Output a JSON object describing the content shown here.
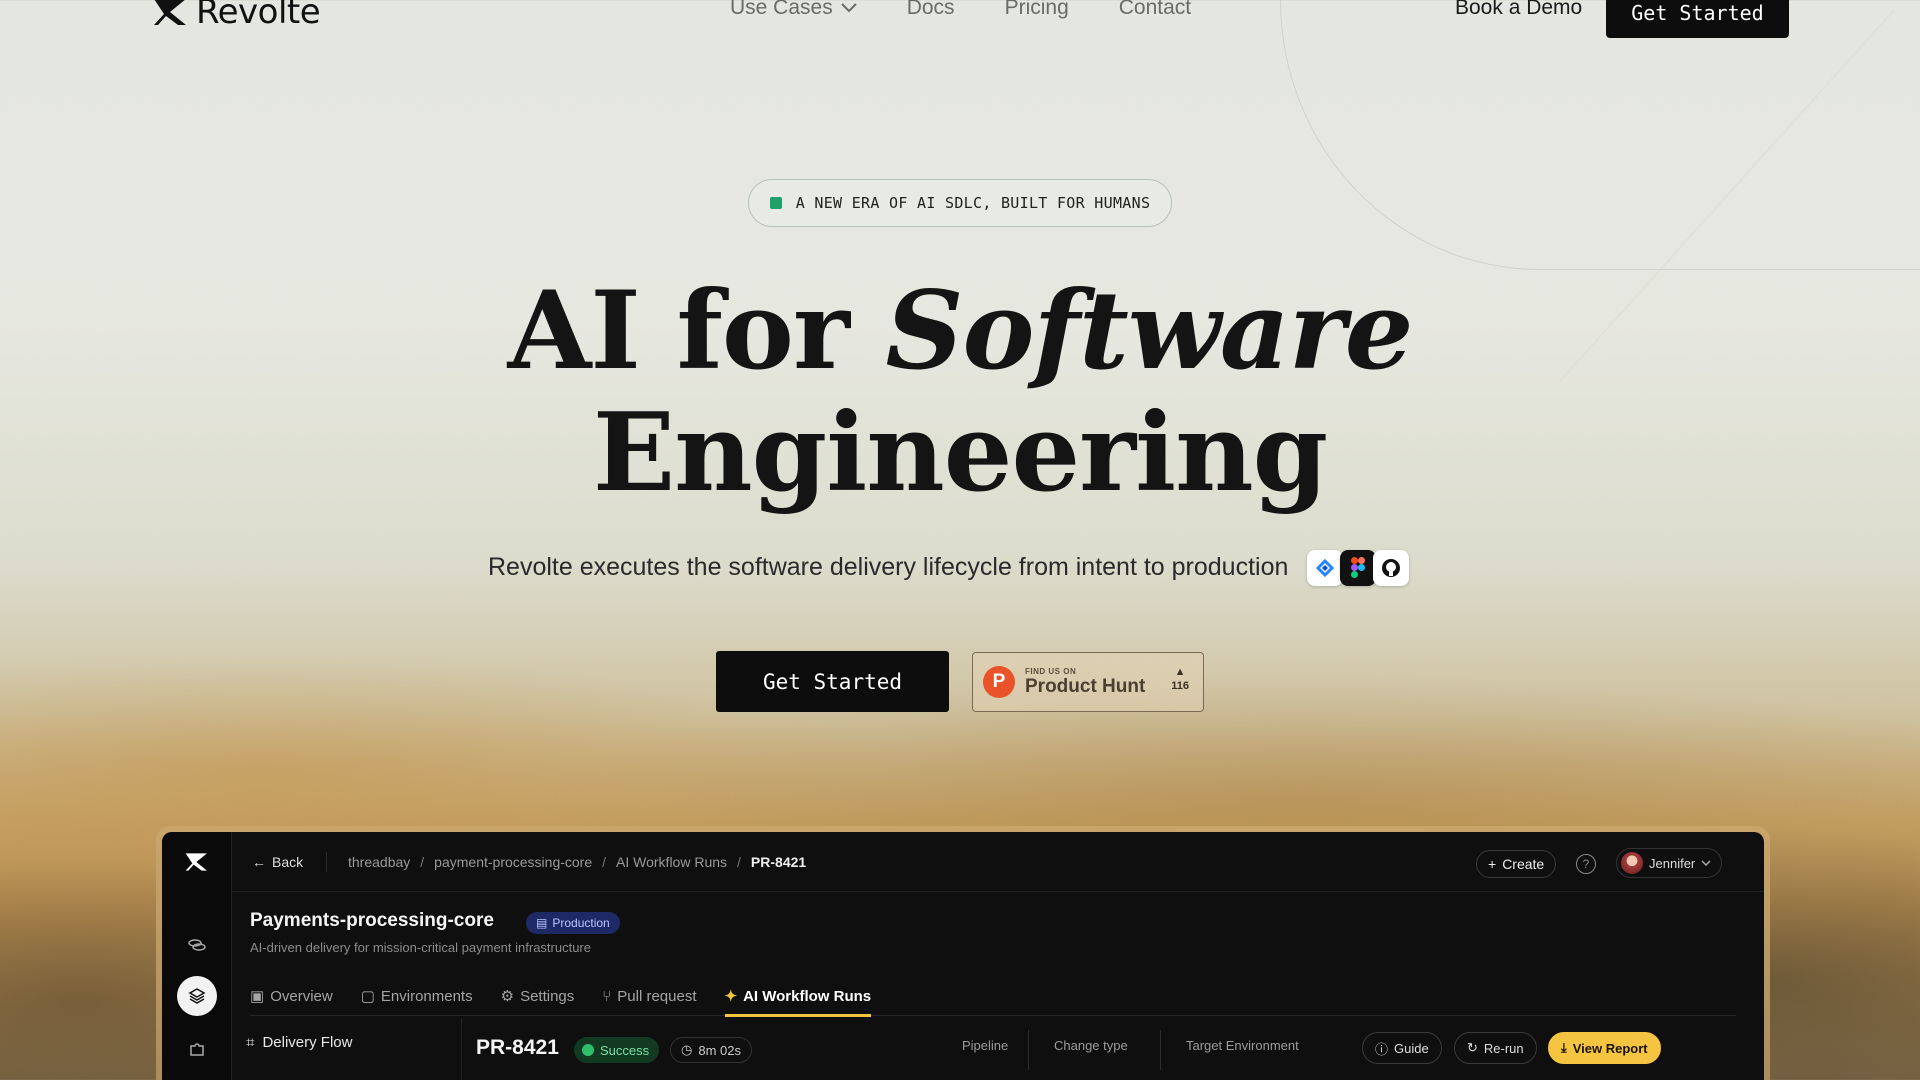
{
  "nav": {
    "brand": "Revolte",
    "links": [
      {
        "label": "Use Cases",
        "has_dropdown": true
      },
      {
        "label": "Docs"
      },
      {
        "label": "Pricing"
      },
      {
        "label": "Contact"
      }
    ],
    "book_demo": "Book a Demo",
    "get_started": "Get Started"
  },
  "hero": {
    "badge": "A NEW ERA OF AI SDLC, BUILT FOR HUMANS",
    "headline_plain": "AI for ",
    "headline_italic": "Software",
    "headline_line2": "Engineering",
    "subline": "Revolte executes the software delivery lifecycle from intent to production",
    "integrations": [
      "jira-icon",
      "figma-icon",
      "github-icon"
    ],
    "cta": "Get Started",
    "product_hunt": {
      "small": "FIND US ON",
      "big": "Product Hunt",
      "count": "116"
    }
  },
  "app": {
    "back": "Back",
    "breadcrumbs": [
      "threadbay",
      "payment-processing-core",
      "AI Workflow Runs",
      "PR-8421"
    ],
    "create": "Create",
    "help": "?",
    "user": "Jennifer",
    "project_title": "Payments-processing-core",
    "env_badge": "Production",
    "project_desc": "AI-driven delivery for mission-critical payment infrastructure",
    "tabs": [
      "Overview",
      "Environments",
      "Settings",
      "Pull request",
      "AI Workflow Runs"
    ],
    "active_tab": "AI Workflow Runs",
    "side_item": "Delivery Flow",
    "run": {
      "id": "PR-8421",
      "status": "Success",
      "duration": "8m 02s",
      "columns": [
        "Pipeline",
        "Change type",
        "Target Environment"
      ]
    },
    "actions": {
      "guide": "Guide",
      "rerun": "Re-run",
      "view_report": "View Report"
    }
  },
  "colors": {
    "accent_yellow": "#f5c542",
    "success_green": "#2fbf6b",
    "brand_dark": "#0d0d0d",
    "badge_dot": "#1fa06a"
  }
}
